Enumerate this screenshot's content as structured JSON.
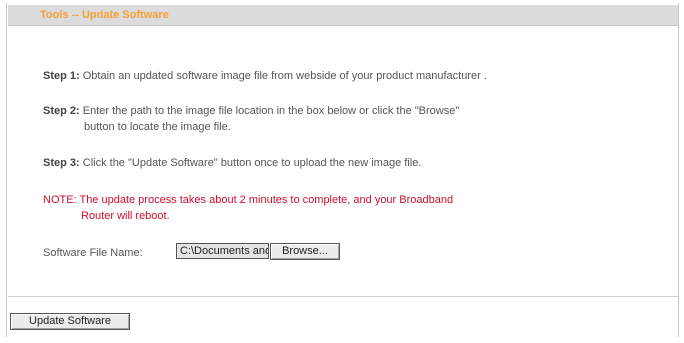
{
  "header": {
    "title": "Tools -- Update Software"
  },
  "steps": {
    "step1": {
      "label": "Step 1:",
      "text": "Obtain an updated software image file from webside of your product manufacturer ."
    },
    "step2": {
      "label": "Step 2:",
      "line1": "Enter the path to the image file location in the box below or click the \"Browse\"",
      "line2": "button to locate the image file."
    },
    "step3": {
      "label": "Step 3:",
      "text": "Click the \"Update Software\" button once to upload the new image file."
    }
  },
  "note": {
    "line1": "NOTE: The update process takes about 2 minutes to complete, and your Broadband",
    "line2": "Router will reboot."
  },
  "file": {
    "label": "Software File Name:",
    "value": "C:\\Documents and",
    "browse_label": "Browse..."
  },
  "actions": {
    "update_label": "Update Software"
  },
  "colors": {
    "title": "#f5a036",
    "note": "#c8102e",
    "header_bg": "#dcdcdc"
  }
}
